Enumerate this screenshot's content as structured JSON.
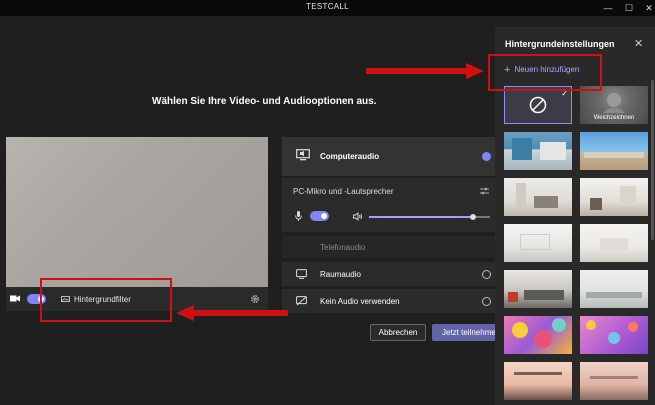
{
  "window": {
    "title": "TESTCALL",
    "minimize_glyph": "—",
    "maximize_glyph": "☐",
    "close_glyph": "✕"
  },
  "main": {
    "heading": "Wählen Sie Ihre Video- und Audiooptionen aus.",
    "background_filter_label": "Hintergrundfilter",
    "camera_on": true
  },
  "audio": {
    "options": [
      {
        "label": "Computeraudio",
        "selected": true
      },
      {
        "label": "Telefonaudio",
        "selected": false
      },
      {
        "label": "Raumaudio",
        "selected": false
      },
      {
        "label": "Kein Audio verwenden",
        "selected": false
      }
    ],
    "device_label": "PC-Mikro und -Lautsprecher",
    "mic_on": true,
    "volume_fraction": 0.86
  },
  "buttons": {
    "cancel": "Abbrechen",
    "join": "Jetzt teilnehmen"
  },
  "background_panel": {
    "title": "Hintergrundeinstellungen",
    "close_glyph": "✕",
    "add_new_label": "Neuen hinzufügen",
    "add_glyph": "+",
    "selected_check": "✓",
    "blur_label": "Weichzeichnen"
  },
  "colors": {
    "accent": "#6264a7",
    "accent_light": "#7f85f5",
    "annotation_red": "#d01010"
  }
}
